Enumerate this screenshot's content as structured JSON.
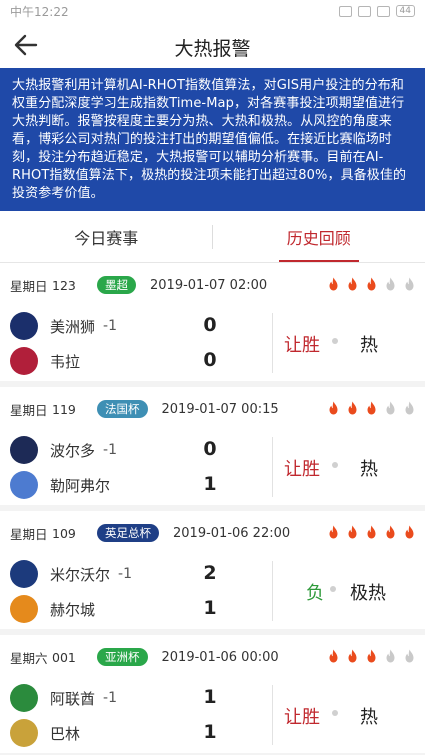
{
  "statusbar": {
    "time": "中午12:22",
    "battery": "44"
  },
  "header": {
    "title": "大热报警"
  },
  "banner": {
    "text": "大热报警利用计算机AI-RHOT指数值算法，对GIS用户投注的分布和权重分配深度学习生成指数Time-Map，对各赛事投注项期望值进行大热判断。报警按程度主要分为热、大热和极热。从风控的角度来看，博彩公司对热门的投注打出的期望值偏低。在接近比赛临场时刻，投注分布趋近稳定，大热报警可以辅助分析赛事。目前在AI-RHOT指数值算法下，极热的投注项未能打出超过80%，具备极佳的投资参考价值。"
  },
  "tabs": [
    {
      "label": "今日赛事"
    },
    {
      "label": "历史回顾"
    }
  ],
  "colors": {
    "accent": "#c0282e",
    "flame_on": "#ea4b1d",
    "flame_off": "#c9c9c9",
    "banner": "#1f49a8"
  },
  "matches": [
    {
      "weekday": "星期日",
      "num": "123",
      "league": "墨超",
      "league_color": "#2aa74a",
      "datetime": "2019-01-07 02:00",
      "flames_on": 3,
      "flames_total": 5,
      "home": {
        "name": "美洲狮",
        "handicap": "-1",
        "score": "0",
        "logo_color": "#1b2f6b",
        "logo_icon": "pumas-logo-icon"
      },
      "away": {
        "name": "韦拉",
        "handicap": "",
        "score": "0",
        "logo_color": "#b11f3a",
        "logo_icon": "veracruz-logo-icon"
      },
      "result": "让胜",
      "result_color": "red",
      "heat": "热"
    },
    {
      "weekday": "星期日",
      "num": "119",
      "league": "法国杯",
      "league_color": "#3e8fb4",
      "datetime": "2019-01-07 00:15",
      "flames_on": 3,
      "flames_total": 5,
      "home": {
        "name": "波尔多",
        "handicap": "-1",
        "score": "0",
        "logo_color": "#1d2a56",
        "logo_icon": "bordeaux-logo-icon"
      },
      "away": {
        "name": "勒阿弗尔",
        "handicap": "",
        "score": "1",
        "logo_color": "#4d7bd0",
        "logo_icon": "le-havre-logo-icon"
      },
      "result": "让胜",
      "result_color": "red",
      "heat": "热"
    },
    {
      "weekday": "星期日",
      "num": "109",
      "league": "英足总杯",
      "league_color": "#1f3f86",
      "datetime": "2019-01-06 22:00",
      "flames_on": 5,
      "flames_total": 5,
      "home": {
        "name": "米尔沃尔",
        "handicap": "-1",
        "score": "2",
        "logo_color": "#1c3a7c",
        "logo_icon": "millwall-logo-icon"
      },
      "away": {
        "name": "赫尔城",
        "handicap": "",
        "score": "1",
        "logo_color": "#e58a1c",
        "logo_icon": "hull-city-logo-icon"
      },
      "result": "负",
      "result_color": "green",
      "heat": "极热"
    },
    {
      "weekday": "星期六",
      "num": "001",
      "league": "亚洲杯",
      "league_color": "#2aa74a",
      "datetime": "2019-01-06 00:00",
      "flames_on": 3,
      "flames_total": 5,
      "home": {
        "name": "阿联酋",
        "handicap": "-1",
        "score": "1",
        "logo_color": "#2b8b3d",
        "logo_icon": "uae-logo-icon"
      },
      "away": {
        "name": "巴林",
        "handicap": "",
        "score": "1",
        "logo_color": "#c9a23a",
        "logo_icon": "bahrain-logo-icon"
      },
      "result": "让胜",
      "result_color": "red",
      "heat": "热"
    }
  ]
}
